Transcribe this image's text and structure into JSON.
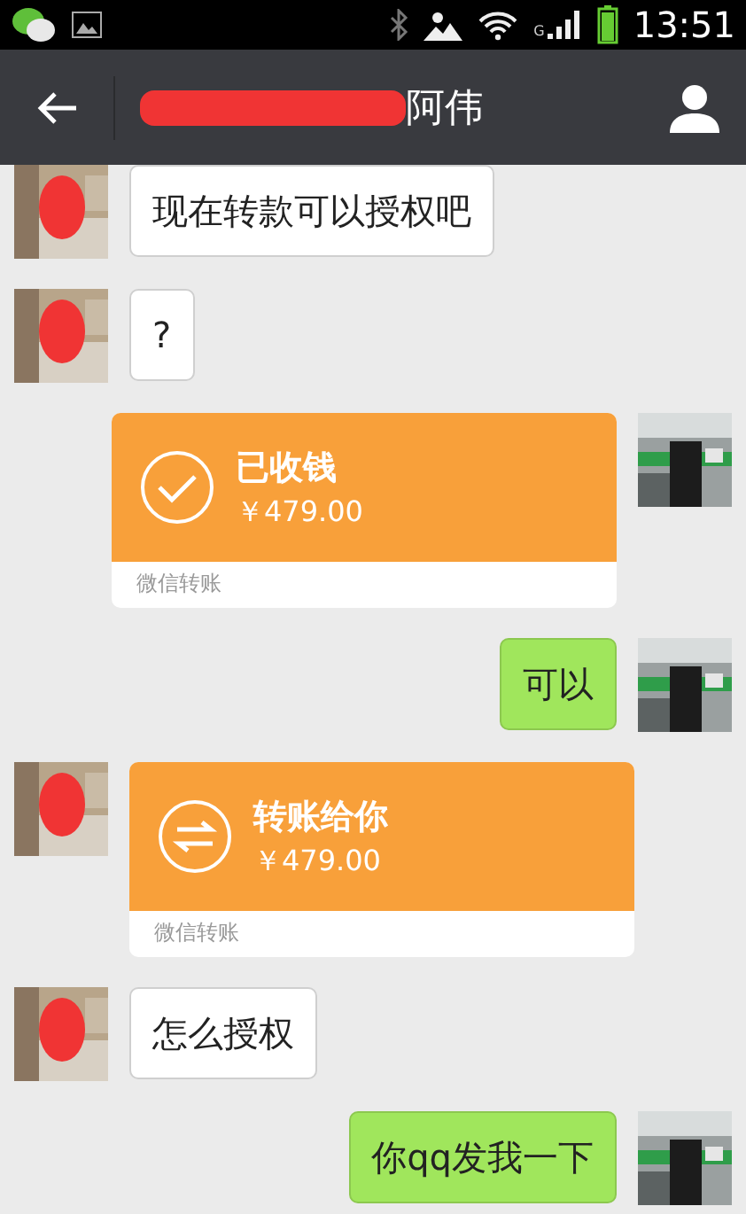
{
  "status_bar": {
    "network": "G",
    "time": "13:51"
  },
  "header": {
    "title": "阿伟",
    "redacted": true
  },
  "messages": [
    {
      "kind": "text",
      "outgoing": false,
      "text": "现在转款可以授权吧"
    },
    {
      "kind": "text",
      "outgoing": false,
      "text": "?"
    },
    {
      "kind": "transfer",
      "outgoing": true,
      "received": true,
      "title": "已收钱",
      "amount": "￥479.00",
      "footer": "微信转账"
    },
    {
      "kind": "text",
      "outgoing": true,
      "text": "可以"
    },
    {
      "kind": "transfer",
      "outgoing": false,
      "received": false,
      "title": "转账给你",
      "amount": "￥479.00",
      "footer": "微信转账"
    },
    {
      "kind": "text",
      "outgoing": false,
      "text": "怎么授权"
    },
    {
      "kind": "text",
      "outgoing": true,
      "text": "你qq发我一下"
    }
  ]
}
